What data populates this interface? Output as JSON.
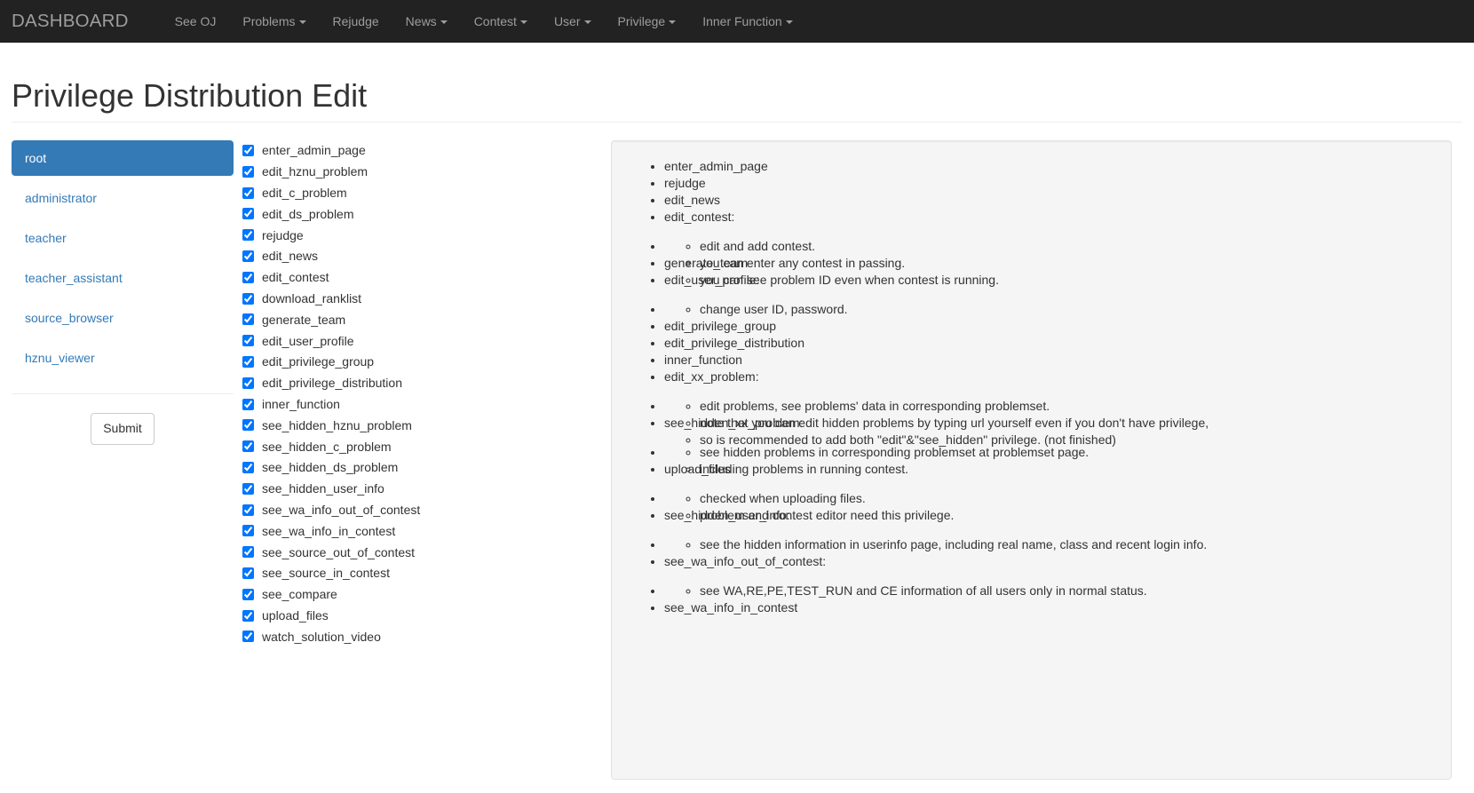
{
  "navbar": {
    "brand": "DASHBOARD",
    "items": [
      {
        "label": "See OJ",
        "caret": false
      },
      {
        "label": "Problems",
        "caret": true
      },
      {
        "label": "Rejudge",
        "caret": false
      },
      {
        "label": "News",
        "caret": true
      },
      {
        "label": "Contest",
        "caret": true
      },
      {
        "label": "User",
        "caret": true
      },
      {
        "label": "Privilege",
        "caret": true
      },
      {
        "label": "Inner Function",
        "caret": true
      }
    ]
  },
  "page": {
    "title": "Privilege Distribution Edit"
  },
  "sidebar": {
    "groups": [
      {
        "label": "root",
        "active": true
      },
      {
        "label": "administrator",
        "active": false
      },
      {
        "label": "teacher",
        "active": false
      },
      {
        "label": "teacher_assistant",
        "active": false
      },
      {
        "label": "source_browser",
        "active": false
      },
      {
        "label": "hznu_viewer",
        "active": false
      }
    ],
    "submit_label": "Submit"
  },
  "privileges": [
    {
      "label": "enter_admin_page",
      "checked": true
    },
    {
      "label": "edit_hznu_problem",
      "checked": true
    },
    {
      "label": "edit_c_problem",
      "checked": true
    },
    {
      "label": "edit_ds_problem",
      "checked": true
    },
    {
      "label": "rejudge",
      "checked": true
    },
    {
      "label": "edit_news",
      "checked": true
    },
    {
      "label": "edit_contest",
      "checked": true
    },
    {
      "label": "download_ranklist",
      "checked": true
    },
    {
      "label": "generate_team",
      "checked": true
    },
    {
      "label": "edit_user_profile",
      "checked": true
    },
    {
      "label": "edit_privilege_group",
      "checked": true
    },
    {
      "label": "edit_privilege_distribution",
      "checked": true
    },
    {
      "label": "inner_function",
      "checked": true
    },
    {
      "label": "see_hidden_hznu_problem",
      "checked": true
    },
    {
      "label": "see_hidden_c_problem",
      "checked": true
    },
    {
      "label": "see_hidden_ds_problem",
      "checked": true
    },
    {
      "label": "see_hidden_user_info",
      "checked": true
    },
    {
      "label": "see_wa_info_out_of_contest",
      "checked": true
    },
    {
      "label": "see_wa_info_in_contest",
      "checked": true
    },
    {
      "label": "see_source_out_of_contest",
      "checked": true
    },
    {
      "label": "see_source_in_contest",
      "checked": true
    },
    {
      "label": "see_compare",
      "checked": true
    },
    {
      "label": "upload_files",
      "checked": true
    },
    {
      "label": "watch_solution_video",
      "checked": true
    }
  ],
  "help_panel": {
    "items": [
      {
        "label": "enter_admin_page",
        "children": []
      },
      {
        "label": "rejudge",
        "children": []
      },
      {
        "label": "edit_news",
        "children": []
      },
      {
        "label": "edit_contest:",
        "children": [
          "edit and add contest.",
          "you can enter any contest in passing.",
          "you can see problem ID even when contest is running."
        ]
      },
      {
        "label": "generate_team",
        "children": []
      },
      {
        "label": "edit_user_profile:",
        "children": [
          "change user ID, password."
        ]
      },
      {
        "label": "edit_privilege_group",
        "children": []
      },
      {
        "label": "edit_privilege_distribution",
        "children": []
      },
      {
        "label": "inner_function",
        "children": []
      },
      {
        "label": "edit_xx_problem:",
        "children": [
          "edit problems, see problems' data in corresponding problemset.",
          "note that you can edit hidden problems by typing url yourself even if you don't have privilege,",
          "so is recommended to add both \"edit\"&\"see_hidden\" privilege. (not finished)"
        ]
      },
      {
        "label": "see_hidden_xx_problem:",
        "children": [
          "see hidden problems in corresponding problemset at problemset page.",
          "including problems in running contest."
        ]
      },
      {
        "label": "upload_files",
        "children": [
          "checked when uploading files.",
          "problem and contest editor need this privilege."
        ]
      },
      {
        "label": "see_hidden_user_info:",
        "children": [
          "see the hidden information in userinfo page, including real name, class and recent login info."
        ]
      },
      {
        "label": "see_wa_info_out_of_contest:",
        "children": [
          "see WA,RE,PE,TEST_RUN and CE information of all users only in normal status."
        ]
      },
      {
        "label": "see_wa_info_in_contest",
        "children": []
      }
    ]
  },
  "colors": {
    "navbar_bg": "#222222",
    "navbar_text": "#9d9d9d",
    "link": "#337ab7",
    "active_bg": "#337ab7",
    "well_bg": "#f5f5f5",
    "well_border": "#e3e3e3"
  }
}
